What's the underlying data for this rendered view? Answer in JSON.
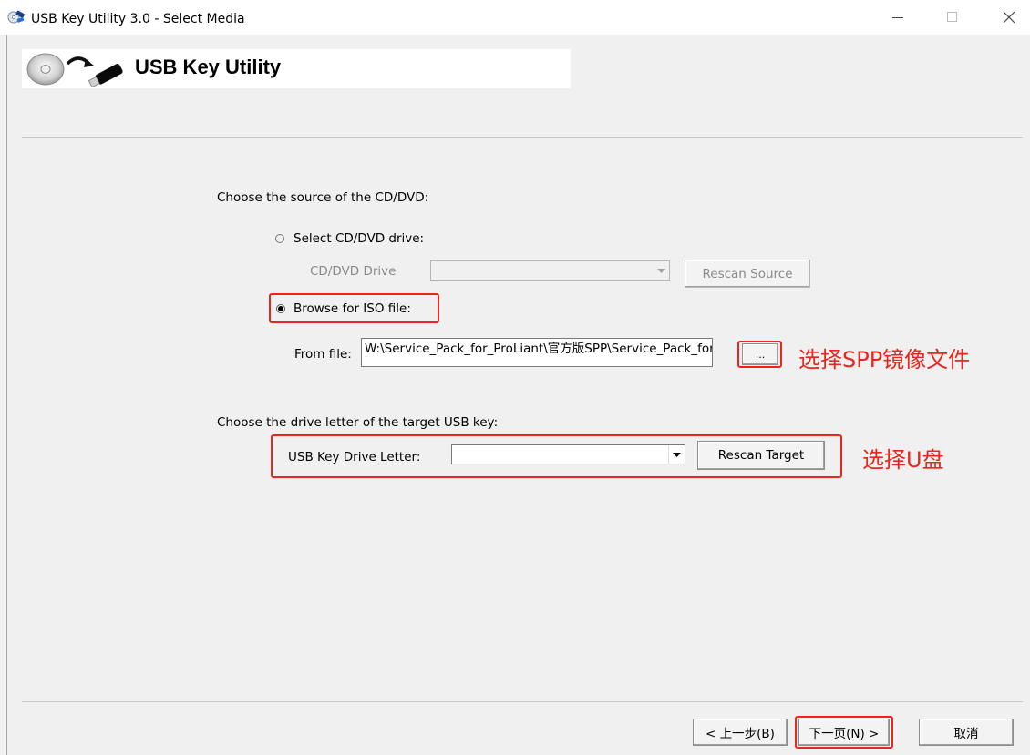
{
  "window": {
    "title": "USB Key Utility 3.0 - Select Media",
    "controls": {
      "minimize": "—",
      "maximize": "□",
      "close": "✕"
    }
  },
  "banner": {
    "title": "USB Key Utility",
    "icon": "cd-to-usb-icon"
  },
  "source": {
    "heading": "Choose the source of the CD/DVD:",
    "option_drive": {
      "label": "Select CD/DVD drive:",
      "selected": false
    },
    "drive_label": "CD/DVD Drive",
    "drive_value": "",
    "rescan_source": "Rescan Source",
    "option_iso": {
      "label": "Browse for ISO file:",
      "selected": true
    },
    "from_file_label": "From file:",
    "from_file_value": "W:\\Service_Pack_for_ProLiant\\官方版SPP\\Service_Pack_for_ProLiant",
    "browse_button": "...",
    "annotation": "选择SPP镜像文件"
  },
  "target": {
    "heading": "Choose the drive letter of the target USB key:",
    "drive_letter_label": "USB Key Drive Letter:",
    "drive_letter_value": "",
    "rescan_target": "Rescan Target",
    "annotation": "选择U盘"
  },
  "footer": {
    "back": "< 上一步(B)",
    "next": "下一页(N) >",
    "cancel": "取消"
  },
  "colors": {
    "annotation": "#e8261e",
    "background": "#f0f0f0"
  }
}
